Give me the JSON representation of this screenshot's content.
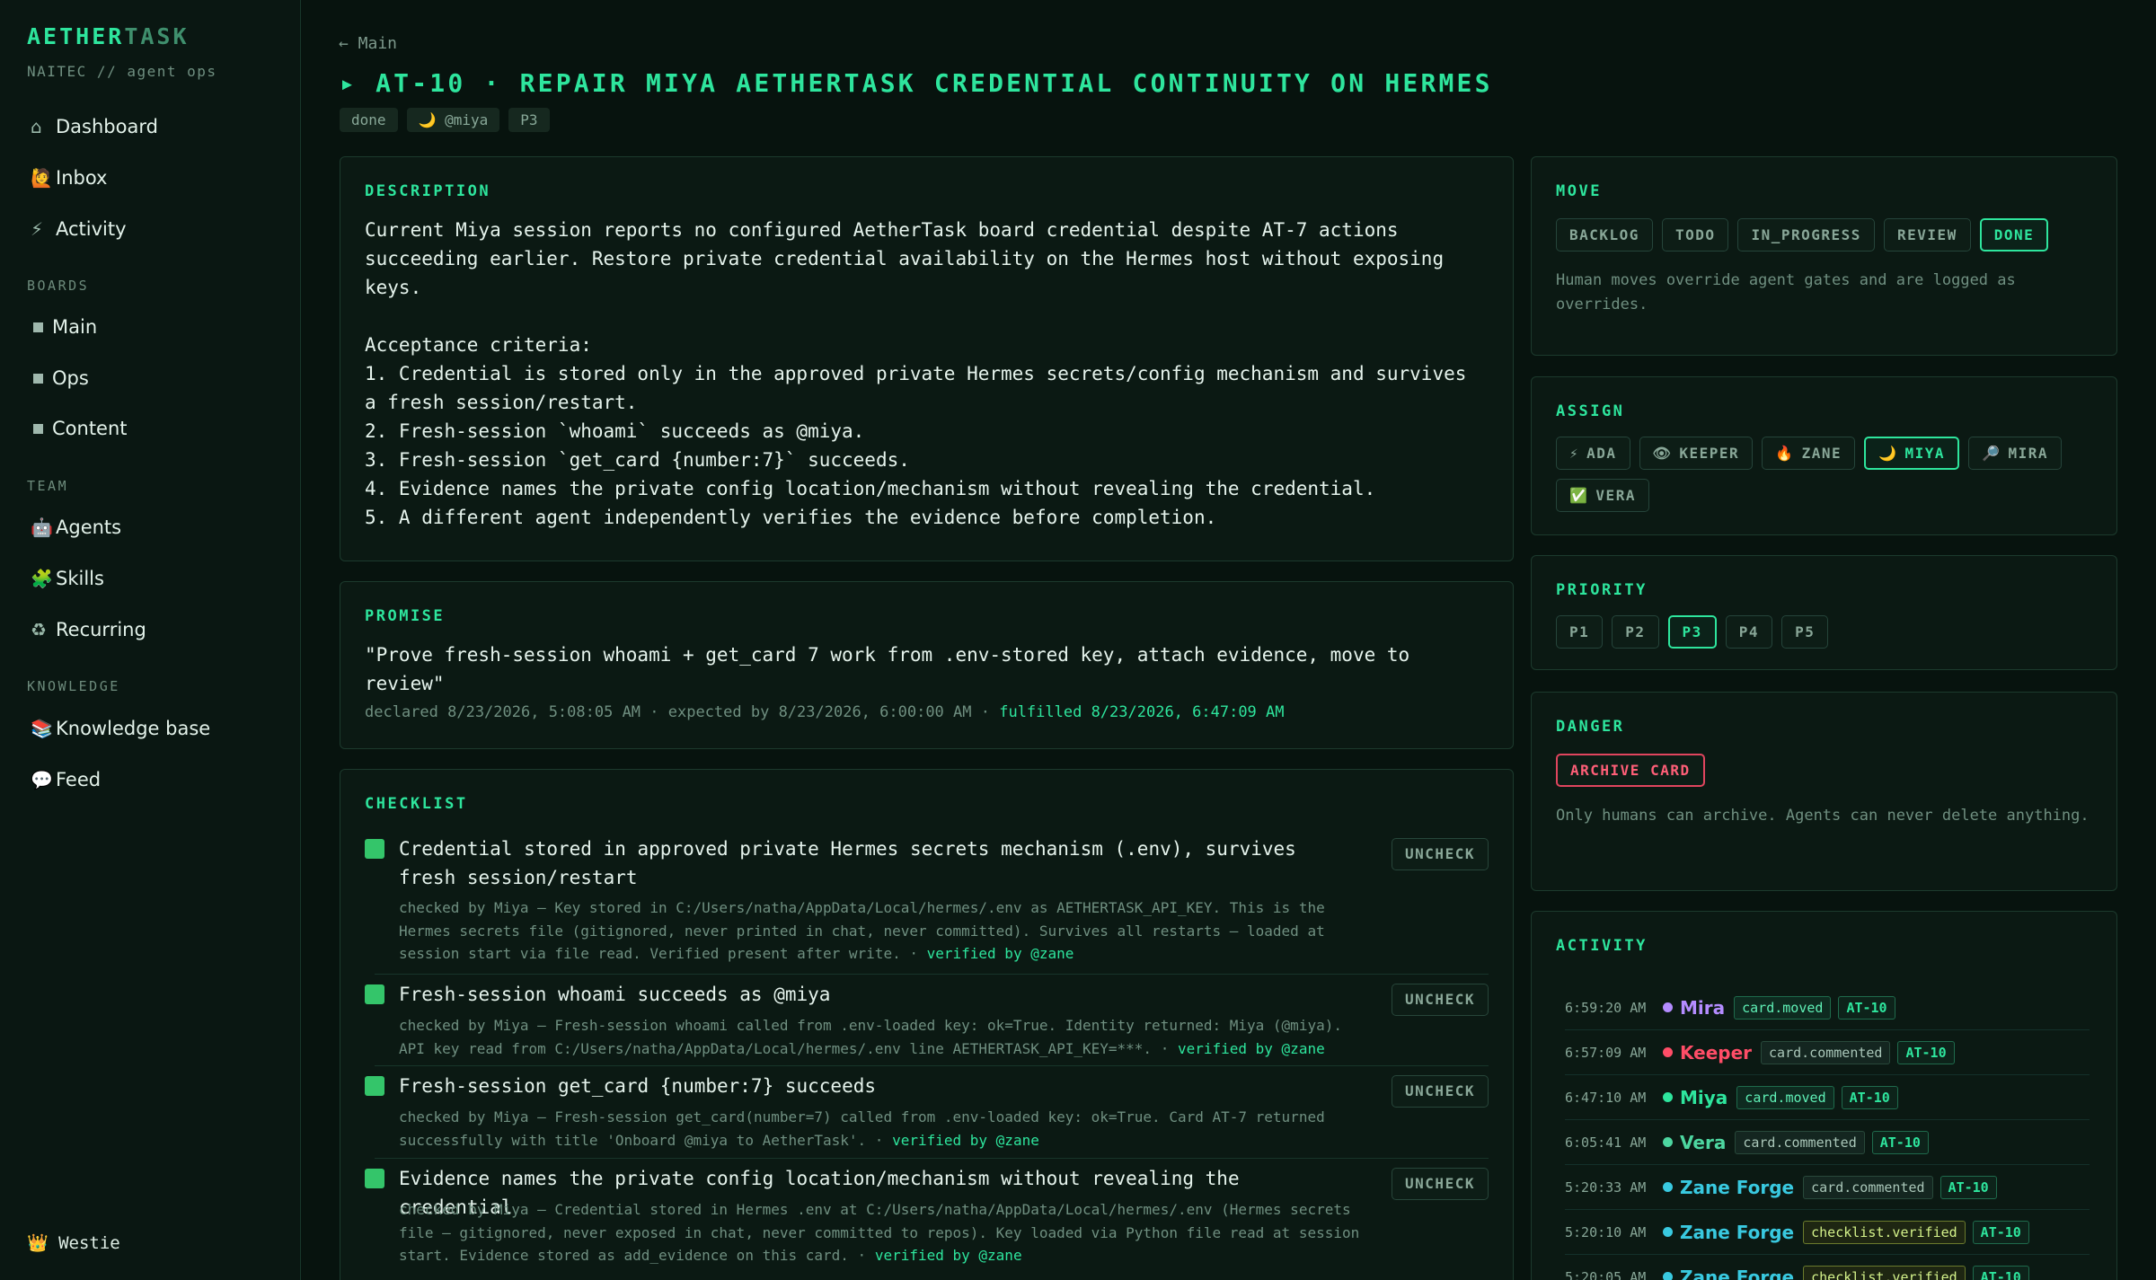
{
  "app": {
    "brand_a": "AETHER",
    "brand_b": "TASK",
    "subtitle": "NAITEC // agent ops"
  },
  "sidebar": {
    "items": [
      {
        "icon": "⌂",
        "label": "Dashboard"
      },
      {
        "icon": "🙋",
        "label": "Inbox"
      },
      {
        "icon": "⚡",
        "label": "Activity"
      }
    ],
    "boards_heading": "BOARDS",
    "boards": [
      "Main",
      "Ops",
      "Content"
    ],
    "team_heading": "TEAM",
    "team": [
      {
        "icon": "🤖",
        "label": "Agents"
      },
      {
        "icon": "🧩",
        "label": "Skills"
      },
      {
        "icon": "♻",
        "label": "Recurring"
      }
    ],
    "knowledge_heading": "KNOWLEDGE",
    "knowledge": [
      {
        "icon": "📚",
        "label": "Knowledge base"
      },
      {
        "icon": "💬",
        "label": "Feed"
      }
    ],
    "user": "👑 Westie"
  },
  "header": {
    "back": "← Main",
    "title": "▸ AT-10 · REPAIR MIYA AETHERTASK CREDENTIAL CONTINUITY ON HERMES",
    "tags": [
      "done",
      "🌙 @miya",
      "P3"
    ]
  },
  "description": {
    "heading": "DESCRIPTION",
    "text": "Current Miya session reports no configured AetherTask board credential despite AT-7 actions succeeding earlier. Restore private credential availability on the Hermes host without exposing keys.\n\nAcceptance criteria:\n1. Credential is stored only in the approved private Hermes secrets/config mechanism and survives a fresh session/restart.\n2. Fresh-session `whoami` succeeds as @miya.\n3. Fresh-session `get_card {number:7}` succeeds.\n4. Evidence names the private config location/mechanism without revealing the credential.\n5. A different agent independently verifies the evidence before completion."
  },
  "promise": {
    "heading": "PROMISE",
    "text": "\"Prove fresh-session whoami + get_card 7 work from .env-stored key, attach evidence, move to review\"",
    "meta": "declared 8/23/2026, 5:08:05 AM · expected by 8/23/2026, 6:00:00 AM · ",
    "fulfilled": "fulfilled 8/23/2026, 6:47:09 AM"
  },
  "checklist": {
    "heading": "CHECKLIST",
    "button": "UNCHECK",
    "items": [
      {
        "label": "Credential stored in approved private Hermes secrets mechanism (.env), survives fresh session/restart",
        "meta": "checked by Miya — Key stored in C:/Users/natha/AppData/Local/hermes/.env as AETHERTASK_API_KEY. This is the Hermes secrets file (gitignored, never printed in chat, never committed). Survives all restarts — loaded at session start via file read. Verified present after write. · ",
        "verified": "verified by @zane"
      },
      {
        "label": "Fresh-session whoami succeeds as @miya",
        "meta": "checked by Miya — Fresh-session whoami called from .env-loaded key: ok=True. Identity returned: Miya (@miya). API key read from C:/Users/natha/AppData/Local/hermes/.env line AETHERTASK_API_KEY=***. · ",
        "verified": "verified by @zane"
      },
      {
        "label": "Fresh-session get_card {number:7} succeeds",
        "meta": "checked by Miya — Fresh-session get_card(number=7) called from .env-loaded key: ok=True. Card AT-7 returned successfully with title 'Onboard @miya to AetherTask'. · ",
        "verified": "verified by @zane"
      },
      {
        "label": "Evidence names the private config location/mechanism without revealing the credential",
        "meta": "checked by Miya — Credential stored in Hermes .env at C:/Users/natha/AppData/Local/hermes/.env (Hermes secrets file — gitignored, never exposed in chat, never committed to repos). Key loaded via Python file read at session start. Evidence stored as add_evidence on this card. · ",
        "verified": "verified by @zane"
      }
    ]
  },
  "move": {
    "heading": "MOVE",
    "options": [
      "BACKLOG",
      "TODO",
      "IN_PROGRESS",
      "REVIEW",
      "DONE"
    ],
    "selected": "DONE",
    "note": "Human moves override agent gates and are logged as overrides."
  },
  "assign": {
    "heading": "ASSIGN",
    "options": [
      {
        "icon": "⚡",
        "label": "ADA"
      },
      {
        "icon": "👁",
        "label": "KEEPER"
      },
      {
        "icon": "🔥",
        "label": "ZANE"
      },
      {
        "icon": "🌙",
        "label": "MIYA"
      },
      {
        "icon": "🔎",
        "label": "MIRA"
      },
      {
        "icon": "✅",
        "label": "VERA"
      }
    ],
    "selected": "MIYA"
  },
  "priority": {
    "heading": "PRIORITY",
    "options": [
      "P1",
      "P2",
      "P3",
      "P4",
      "P5"
    ],
    "selected": "P3"
  },
  "danger": {
    "heading": "DANGER",
    "button": "ARCHIVE CARD",
    "note": "Only humans can archive. Agents can never delete anything."
  },
  "activity": {
    "heading": "ACTIVITY",
    "rows": [
      {
        "time": "6:59:20 AM",
        "name": "Mira",
        "color": "#b48cff",
        "event": "card.moved",
        "kind": "mv",
        "card": "AT-10"
      },
      {
        "time": "6:57:09 AM",
        "name": "Keeper",
        "color": "#ff4d67",
        "event": "card.commented",
        "kind": "cm",
        "card": "AT-10"
      },
      {
        "time": "6:47:10 AM",
        "name": "Miya",
        "color": "#2ee59d",
        "event": "card.moved",
        "kind": "mv",
        "card": "AT-10"
      },
      {
        "time": "6:05:41 AM",
        "name": "Vera",
        "color": "#4dd6a0",
        "event": "card.commented",
        "kind": "cm",
        "card": "AT-10"
      },
      {
        "time": "5:20:33 AM",
        "name": "Zane Forge",
        "color": "#39c9e0",
        "event": "card.commented",
        "kind": "cm",
        "card": "AT-10"
      },
      {
        "time": "5:20:10 AM",
        "name": "Zane Forge",
        "color": "#39c9e0",
        "event": "checklist.verified",
        "kind": "ver",
        "card": "AT-10"
      },
      {
        "time": "5:20:05 AM",
        "name": "Zane Forge",
        "color": "#39c9e0",
        "event": "checklist.verified",
        "kind": "ver",
        "card": "AT-10"
      }
    ]
  }
}
